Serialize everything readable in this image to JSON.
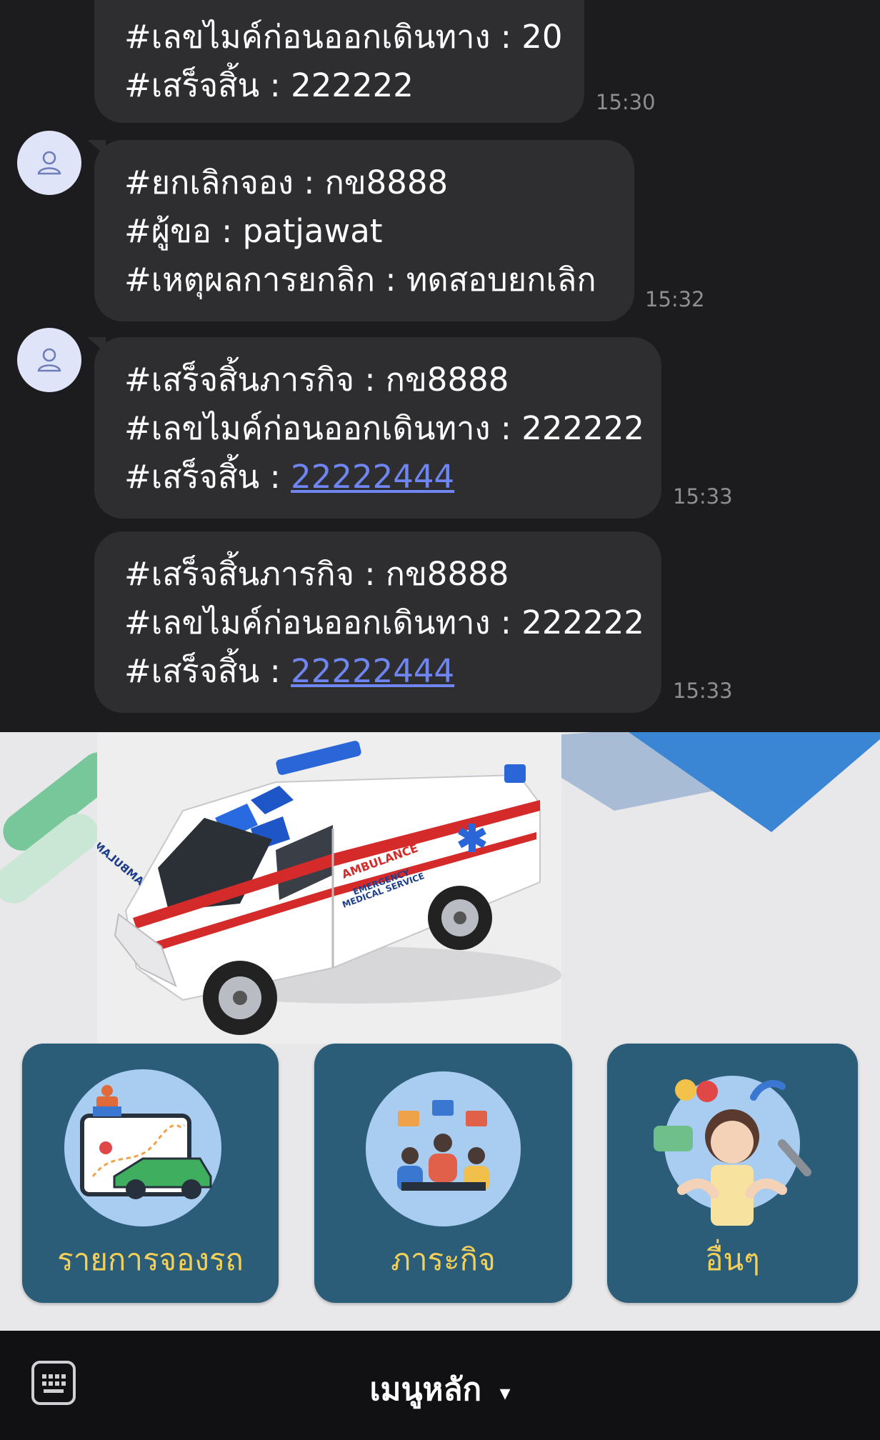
{
  "messages": [
    {
      "lines": [
        "#เลขไมค์ก่อนออกเดินทาง : 20",
        "#เสร็จสิ้น : 222222"
      ],
      "time": "15:30"
    },
    {
      "lines": [
        "#ยกเลิกจอง  : กข8888",
        "#ผู้ขอ : patjawat",
        "#เหตุผลการยกลิก : ทดสอบยกเลิก"
      ],
      "time": "15:32"
    },
    {
      "line1": "#เสร็จสิ้นภารกิจ : กข8888",
      "line2": "#เลขไมค์ก่อนออกเดินทาง : 222222",
      "line3_prefix": "#เสร็จสิ้น : ",
      "line3_link": "22222444",
      "time": "15:33"
    },
    {
      "line1": "#เสร็จสิ้นภารกิจ : กข8888",
      "line2": "#เลขไมค์ก่อนออกเดินทาง : 222222",
      "line3_prefix": "#เสร็จสิ้น : ",
      "line3_link": "22222444",
      "time": "15:33"
    }
  ],
  "ambulance": {
    "side_text": "AMBULANCE",
    "service_text_1": "EMERGENCY",
    "service_text_2": "MEDICAL SERVICE",
    "front_text": "AMBULANCE"
  },
  "rich_menu": {
    "items": [
      {
        "label": "รายการจองรถ",
        "icon": "car-map-icon"
      },
      {
        "label": "ภาระกิจ",
        "icon": "team-meeting-icon"
      },
      {
        "label": "อื่นๆ",
        "icon": "support-agent-icon"
      }
    ]
  },
  "bottom_bar": {
    "menu_title": "เมนูหลัก",
    "menu_arrow": "▾",
    "keyboard_icon": "keyboard-icon"
  },
  "colors": {
    "chat_bg": "#1c1c1e",
    "bubble": "#2e2e30",
    "link": "#6f86f2",
    "card": "#2c5d78",
    "card_label": "#f2d05a"
  }
}
